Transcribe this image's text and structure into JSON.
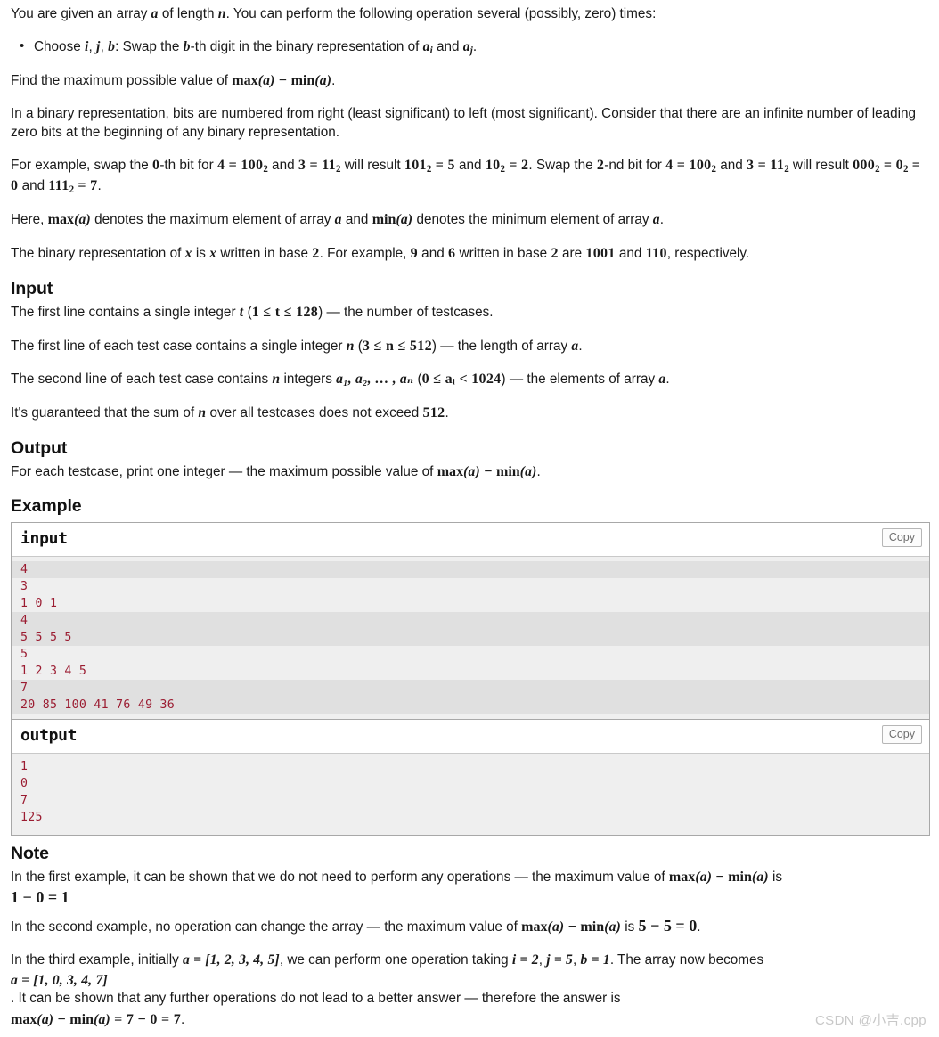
{
  "statement": {
    "intro": {
      "pre": "You are given an array ",
      "var_a": "a",
      "mid": " of length ",
      "var_n": "n",
      "post": ". You can perform the following operation several (possibly, zero) times:"
    },
    "bullet": {
      "p1": "Choose ",
      "v_i": "i",
      "c1": ", ",
      "v_j": "j",
      "c2": ", ",
      "v_b": "b",
      "p2": ": Swap the ",
      "v_b2": "b",
      "p3": "-th digit in the binary representation of ",
      "v_ai": "a",
      "sub_i": "i",
      "p4": " and ",
      "v_aj": "a",
      "sub_j": "j",
      "p5": "."
    },
    "find_line": {
      "pre": "Find the maximum possible value of ",
      "max": "max",
      "max_arg": "(a)",
      "minus": " − ",
      "min": "min",
      "min_arg": "(a)",
      "post": "."
    },
    "binary_note": "In a binary representation, bits are numbered from right (least significant) to left (most significant). Consider that there are an infinite number of leading zero bits at the beginning of any binary representation.",
    "example_swap": {
      "l1_a": "For example, swap the ",
      "l1_zero": "0",
      "l1_b": "-th bit for ",
      "eq1": "4 = 100",
      "sub2a": "2",
      "l1_c": " and ",
      "eq2": "3 = 11",
      "sub2b": "2",
      "l1_d": " will result ",
      "eq3": "101",
      "sub2c": "2",
      "eq3b": " = 5",
      "l1_e": " and ",
      "eq4": "10",
      "sub2d": "2",
      "eq4b": " = 2",
      "l1_f": ". Swap the ",
      "two_nd": "2",
      "l1_g": "-nd bit for ",
      "eq5": "4 = 100",
      "sub2e": "2",
      "l1_h": " and ",
      "eq6": "3 = 11",
      "sub2f": "2",
      "l1_i": " will result ",
      "eq7": "000",
      "sub2g": "2",
      "eq7b": " = 0",
      "sub2h": "2",
      "eq7c": " = 0",
      "l1_j": " and ",
      "eq8": "111",
      "sub2i": "2",
      "eq8b": " = 7",
      "l1_k": "."
    },
    "here_line": {
      "pre": "Here, ",
      "max": "max",
      "max_arg": "(a)",
      "mid1": " denotes the maximum element of array ",
      "var_a1": "a",
      "mid2": " and ",
      "min": "min",
      "min_arg": "(a)",
      "mid3": " denotes the minimum element of array ",
      "var_a2": "a",
      "post": "."
    },
    "binrep_line": {
      "p1": "The binary representation of ",
      "x1": "x",
      "p2": " is ",
      "x2": "x",
      "p3": " written in base ",
      "two1": "2",
      "p4": ". For example, ",
      "nine": "9",
      "p5": " and ",
      "six": "6",
      "p6": " written in base ",
      "two2": "2",
      "p7": " are ",
      "b1001": "1001",
      "p8": " and ",
      "b110": "110",
      "p9": ", respectively."
    }
  },
  "input_section": {
    "heading": "Input",
    "line1": {
      "p1": "The first line contains a single integer ",
      "v_t": "t",
      "p2": " (",
      "constraint": "1 ≤ t ≤ 128",
      "p3": ") — the number of testcases."
    },
    "line2": {
      "p1": "The first line of each test case contains a single integer ",
      "v_n": "n",
      "p2": " (",
      "constraint": "3 ≤ n ≤ 512",
      "p3": ") — the length of array ",
      "v_a": "a",
      "p4": "."
    },
    "line3": {
      "p1": "The second line of each test case contains ",
      "v_n": "n",
      "p2": " integers ",
      "arr": "a₁, a₂, … , aₙ",
      "p3": " (",
      "constraint": "0 ≤ aᵢ < 1024",
      "p4": ") — the elements of array ",
      "v_a": "a",
      "p5": "."
    },
    "line4": {
      "p1": "It's guaranteed that the sum of ",
      "v_n": "n",
      "p2": " over all testcases does not exceed ",
      "num": "512",
      "p3": "."
    }
  },
  "output_section": {
    "heading": "Output",
    "line1": {
      "p1": "For each testcase, print one integer — the maximum possible value of ",
      "max": "max",
      "max_arg": "(a)",
      "minus": " − ",
      "min": "min",
      "min_arg": "(a)",
      "p2": "."
    }
  },
  "example_section": {
    "heading": "Example",
    "input_block": {
      "title": "input",
      "copy_label": "Copy",
      "lines": [
        {
          "text": "4",
          "shaded": true
        },
        {
          "text": "3",
          "shaded": false
        },
        {
          "text": "1 0 1",
          "shaded": false
        },
        {
          "text": "4",
          "shaded": true
        },
        {
          "text": "5 5 5 5",
          "shaded": true
        },
        {
          "text": "5",
          "shaded": false
        },
        {
          "text": "1 2 3 4 5",
          "shaded": false
        },
        {
          "text": "7",
          "shaded": true
        },
        {
          "text": "20 85 100 41 76 49 36",
          "shaded": true
        }
      ]
    },
    "output_block": {
      "title": "output",
      "copy_label": "Copy",
      "lines": [
        {
          "text": "1",
          "shaded": false
        },
        {
          "text": "0",
          "shaded": false
        },
        {
          "text": "7",
          "shaded": false
        },
        {
          "text": "125",
          "shaded": false
        }
      ]
    }
  },
  "note_section": {
    "heading": "Note",
    "note1": {
      "p1": "In the first example, it can be shown that we do not need to perform any operations — the maximum value of ",
      "max": "max",
      "max_arg": "(a)",
      "minus": " − ",
      "min": "min",
      "min_arg": "(a)",
      "p2": " is",
      "eq": "1 − 0 = 1",
      "p3": "."
    },
    "note2": {
      "p1": "In the second example, no operation can change the array — the maximum value of ",
      "max": "max",
      "max_arg": "(a)",
      "minus": " − ",
      "min": "min",
      "min_arg": "(a)",
      "p2": " is ",
      "eq": "5 − 5 = 0",
      "p3": "."
    },
    "note3": {
      "p1": "In the third example, initially ",
      "arr1": "a = [1, 2, 3, 4, 5]",
      "p2": ", we can perform one operation taking ",
      "eq_i": "i = 2",
      "c1": ", ",
      "eq_j": "j = 5",
      "c2": ", ",
      "eq_b": "b = 1",
      "p3": ". The array now becomes",
      "arr2": "a = [1, 0, 3, 4, 7]",
      "p4": ". It can be shown that any further operations do not lead to a better answer — therefore the answer is",
      "final_max": "max",
      "final_max_arg": "(a)",
      "final_minus": " − ",
      "final_min": "min",
      "final_min_arg": "(a)",
      "final_eq": " = 7 − 0 = 7",
      "p5": "."
    }
  },
  "watermark": {
    "text": "CSDN @小吉.cpp"
  },
  "colors": {
    "code_text": "#9b1c31",
    "body_text": "#1a1a1a",
    "stripe": "#e0e0e0",
    "block_bg": "#efefef",
    "border": "#a8a8a8"
  }
}
